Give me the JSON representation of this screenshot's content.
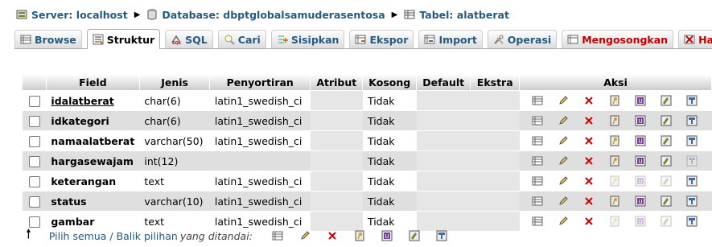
{
  "breadcrumb": {
    "server_label": "Server: localhost",
    "database_label": "Database: dbptglobalsamuderasentosa",
    "table_label": "Tabel: alatberat"
  },
  "tabs": [
    {
      "label": "Browse",
      "icon": "browse-icon"
    },
    {
      "label": "Struktur",
      "icon": "struktur-icon"
    },
    {
      "label": "SQL",
      "icon": "sql-icon"
    },
    {
      "label": "Cari",
      "icon": "search-icon"
    },
    {
      "label": "Sisipkan",
      "icon": "insert-icon"
    },
    {
      "label": "Ekspor",
      "icon": "export-icon"
    },
    {
      "label": "Import",
      "icon": "import-icon"
    },
    {
      "label": "Operasi",
      "icon": "operations-icon"
    },
    {
      "label": "Mengosongkan",
      "icon": "empty-icon"
    },
    {
      "label": "Hapus",
      "icon": "drop-icon"
    }
  ],
  "columns": {
    "field": "Field",
    "jenis": "Jenis",
    "penyortiran": "Penyortiran",
    "atribut": "Atribut",
    "kosong": "Kosong",
    "default": "Default",
    "ekstra": "Ekstra",
    "aksi": "Aksi"
  },
  "rows": [
    {
      "field": "idalatberat",
      "jenis": "char(6)",
      "penyortiran": "latin1_swedish_ci",
      "atribut": "",
      "kosong": "Tidak",
      "default": "",
      "ekstra": ""
    },
    {
      "field": "idkategori",
      "jenis": "char(6)",
      "penyortiran": "latin1_swedish_ci",
      "atribut": "",
      "kosong": "Tidak",
      "default": "",
      "ekstra": ""
    },
    {
      "field": "namaalatberat",
      "jenis": "varchar(50)",
      "penyortiran": "latin1_swedish_ci",
      "atribut": "",
      "kosong": "Tidak",
      "default": "",
      "ekstra": ""
    },
    {
      "field": "hargasewajam",
      "jenis": "int(12)",
      "penyortiran": "",
      "atribut": "",
      "kosong": "Tidak",
      "default": "",
      "ekstra": ""
    },
    {
      "field": "keterangan",
      "jenis": "text",
      "penyortiran": "latin1_swedish_ci",
      "atribut": "",
      "kosong": "Tidak",
      "default": "",
      "ekstra": ""
    },
    {
      "field": "status",
      "jenis": "varchar(10)",
      "penyortiran": "latin1_swedish_ci",
      "atribut": "",
      "kosong": "Tidak",
      "default": "",
      "ekstra": ""
    },
    {
      "field": "gambar",
      "jenis": "text",
      "penyortiran": "latin1_swedish_ci",
      "atribut": "",
      "kosong": "Tidak",
      "default": "",
      "ekstra": ""
    }
  ],
  "footer": {
    "select_all": "Pilih semua / Balik pilihan",
    "with_selected": "yang ditandai:"
  },
  "colors": {
    "link": "#235a81",
    "row_even": "#dfdfdf",
    "delete_red": "#c00000"
  }
}
